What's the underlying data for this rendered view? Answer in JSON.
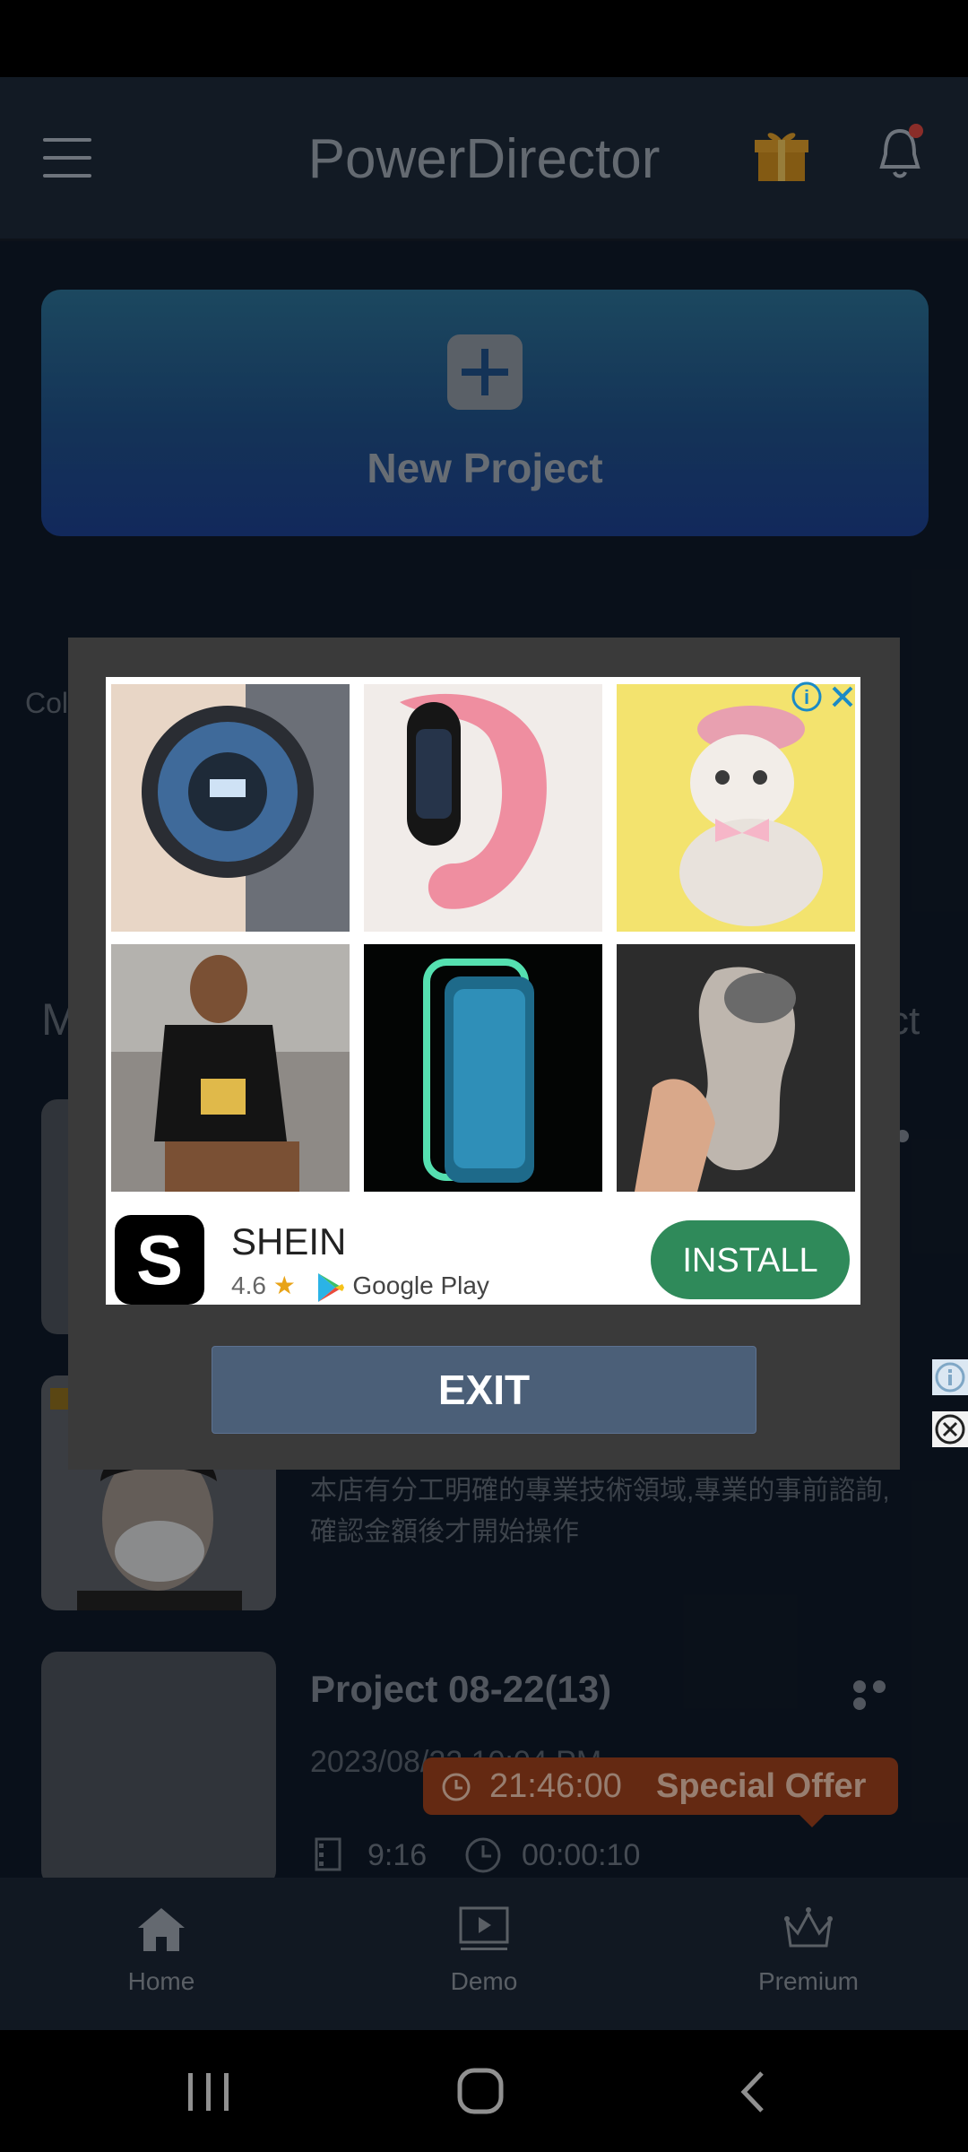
{
  "header": {
    "title": "PowerDirector"
  },
  "new_project": {
    "label": "New Project"
  },
  "background": {
    "feature_partial_left": "Col",
    "section_partial_left": "M",
    "section_partial_right": "ct",
    "projects": [
      {
        "title": "",
        "description": "本店有分工明確的專業技術領域,專業的事前諮詢,確認金額後才開始操作"
      },
      {
        "title": "Project 08-22(13)",
        "date": "2023/08/22 10:04 PM",
        "aspect": "9:16",
        "duration": "00:00:10"
      }
    ],
    "offer": {
      "timer": "21:46:00",
      "label": "Special Offer"
    }
  },
  "bottom_nav": {
    "home": "Home",
    "demo": "Demo",
    "premium": "Premium"
  },
  "ad": {
    "app_name": "SHEIN",
    "logo_letter": "S",
    "rating": "4.6",
    "store": "Google Play",
    "install_label": "INSTALL",
    "info_symbol": "i",
    "close_symbol": "✕",
    "exit_label": "EXIT",
    "tiles": [
      {
        "name": "smartwatch"
      },
      {
        "name": "fitness-band"
      },
      {
        "name": "cat-in-beret"
      },
      {
        "name": "basketball-jersey-model"
      },
      {
        "name": "glowing-phone-case"
      },
      {
        "name": "silicone-insert"
      }
    ]
  },
  "colors": {
    "accent_gradient_top": "#2b6f93",
    "accent_gradient_bottom": "#1d3f8e",
    "install_green": "#2f8a5a",
    "offer_orange": "#9a3f1c",
    "exit_button": "#4b5f78"
  }
}
